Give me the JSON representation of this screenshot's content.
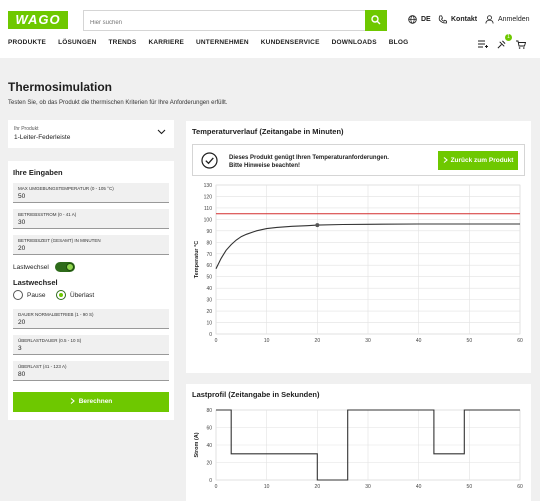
{
  "header": {
    "logo": "WAGO",
    "search_placeholder": "Hier suchen",
    "language": "DE",
    "contact": "Kontakt",
    "login": "Anmelden",
    "cart_badge": "1"
  },
  "nav": {
    "items": [
      "PRODUKTE",
      "LÖSUNGEN",
      "TRENDS",
      "KARRIERE",
      "UNTERNEHMEN",
      "KUNDENSERVICE",
      "DOWNLOADS",
      "BLOG"
    ]
  },
  "page": {
    "title": "Thermosimulation",
    "subtitle": "Testen Sie, ob das Produkt die thermischen Kriterien für Ihre Anforderungen erfüllt."
  },
  "product": {
    "label": "Ihr Produkt",
    "value": "1-Leiter-Federleiste"
  },
  "inputs": {
    "title": "Ihre Eingaben",
    "fields": [
      {
        "label": "MAX UMGEBUNGSTEMPERATUR (0 - 105 °C)",
        "value": "50"
      },
      {
        "label": "BETRIEBSSTROM (0 - 41 A)",
        "value": "30"
      },
      {
        "label": "BETRIEBSZEIT (GESAMT) IN MINUTEN",
        "value": "20"
      }
    ],
    "toggle_label": "Lastwechsel",
    "load_title": "Lastwechsel",
    "radio_pause": "Pause",
    "radio_overload": "Überlast",
    "load_fields": [
      {
        "label": "DAUER NORMALBETRIEB (1 - 90 S)",
        "value": "20"
      },
      {
        "label": "ÜBERLASTDAUER (0.5 - 10 S)",
        "value": "3"
      },
      {
        "label": "ÜBERLAST (41 - 123 A)",
        "value": "80"
      }
    ],
    "calc_button": "Berechnen"
  },
  "temp_chart": {
    "title": "Temperaturverlauf (Zeitangabe in Minuten)",
    "notice": "Dieses Produkt genügt Ihren Temperaturanforderungen. Bitte Hinweise beachten!",
    "back_button": "Zurück zum Produkt",
    "ylabel": "Temperatur °C",
    "y_ticks": [
      "130",
      "120",
      "110",
      "100",
      "90",
      "80",
      "70",
      "60",
      "50",
      "40",
      "30",
      "20",
      "10",
      "0"
    ],
    "x_ticks": [
      "0",
      "10",
      "20",
      "30",
      "40",
      "50",
      "60"
    ]
  },
  "load_chart": {
    "title": "Lastprofil (Zeitangabe in Sekunden)",
    "ylabel": "Strom (A)",
    "y_ticks": [
      "80",
      "60",
      "40",
      "20",
      "0"
    ],
    "x_ticks": [
      "0",
      "10",
      "20",
      "30",
      "40",
      "50",
      "60"
    ]
  },
  "chart_data": [
    {
      "type": "line",
      "title": "Temperaturverlauf (Zeitangabe in Minuten)",
      "xlabel": "",
      "ylabel": "Temperatur °C",
      "xlim": [
        0,
        60
      ],
      "ylim": [
        0,
        130
      ],
      "grid": true,
      "series": [
        {
          "color": "#333333",
          "x": [
            0,
            1,
            2,
            3,
            4,
            5,
            6,
            8,
            10,
            12,
            15,
            18,
            20,
            25,
            30,
            40,
            50,
            60
          ],
          "y": [
            57,
            66,
            73,
            78,
            82,
            85,
            87,
            90,
            92,
            93,
            94,
            94.5,
            95,
            95.5,
            95.7,
            96,
            96,
            96
          ]
        },
        {
          "color": "#d32f2f",
          "x": [
            0,
            60
          ],
          "y": [
            105,
            105
          ]
        }
      ],
      "marker": {
        "x": 20,
        "y": 95
      }
    },
    {
      "type": "line",
      "title": "Lastprofil (Zeitangabe in Sekunden)",
      "xlabel": "",
      "ylabel": "Strom (A)",
      "xlim": [
        0,
        60
      ],
      "ylim": [
        0,
        80
      ],
      "grid": true,
      "series": [
        {
          "color": "#333333",
          "x": [
            0,
            3,
            3,
            20,
            20,
            26,
            26,
            43,
            43,
            49,
            49,
            60
          ],
          "y": [
            80,
            80,
            30,
            30,
            0,
            0,
            80,
            80,
            30,
            30,
            80,
            80
          ]
        }
      ]
    }
  ]
}
